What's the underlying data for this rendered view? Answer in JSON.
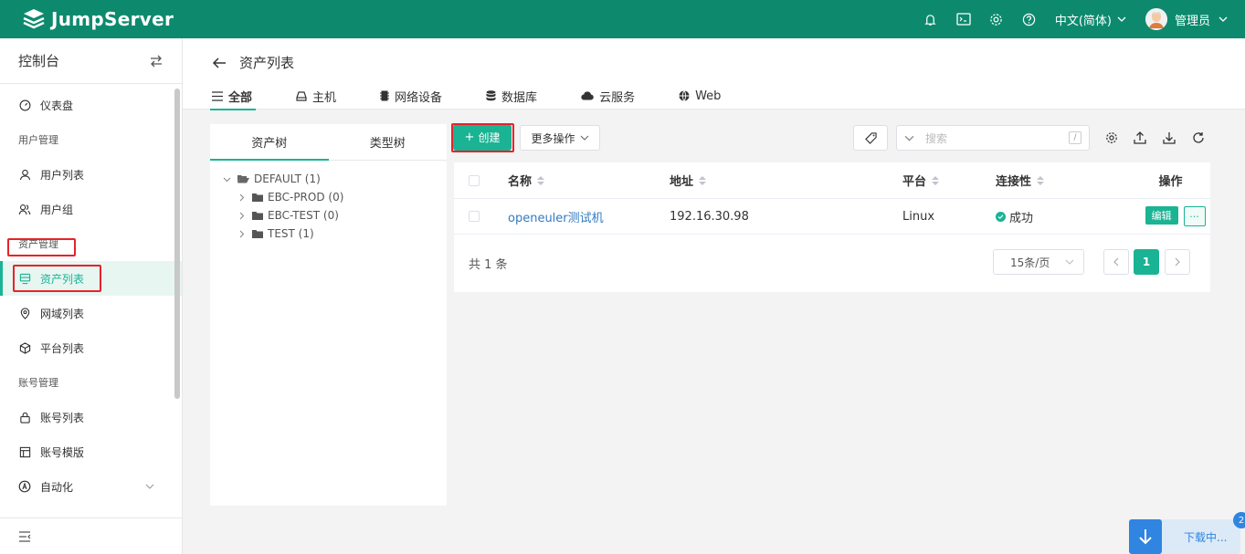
{
  "app": {
    "name": "JumpServer"
  },
  "topbar": {
    "language": "中文(简体)",
    "user": "管理员"
  },
  "sidebar": {
    "title": "控制台",
    "items": [
      {
        "label": "仪表盘"
      },
      {
        "group": "用户管理"
      },
      {
        "label": "用户列表"
      },
      {
        "label": "用户组"
      },
      {
        "group": "资产管理"
      },
      {
        "label": "资产列表"
      },
      {
        "label": "网域列表"
      },
      {
        "label": "平台列表"
      },
      {
        "group": "账号管理"
      },
      {
        "label": "账号列表"
      },
      {
        "label": "账号模版"
      },
      {
        "label": "自动化"
      }
    ]
  },
  "page": {
    "title": "资产列表",
    "tabs": [
      {
        "label": "全部"
      },
      {
        "label": "主机"
      },
      {
        "label": "网络设备"
      },
      {
        "label": "数据库"
      },
      {
        "label": "云服务"
      },
      {
        "label": "Web"
      }
    ]
  },
  "tree": {
    "tabs": [
      {
        "label": "资产树"
      },
      {
        "label": "类型树"
      }
    ],
    "nodes": [
      {
        "label": "DEFAULT (1)"
      },
      {
        "label": "EBC-PROD (0)"
      },
      {
        "label": "EBC-TEST (0)"
      },
      {
        "label": "TEST (1)"
      }
    ]
  },
  "toolbar": {
    "create": "创建",
    "more": "更多操作",
    "search_placeholder": "搜索",
    "search_kbd": "/"
  },
  "table": {
    "columns": [
      "名称",
      "地址",
      "平台",
      "连接性",
      "操作"
    ],
    "rows": [
      {
        "name": "openeuler测试机",
        "address": "192.16.30.98",
        "platform": "Linux",
        "connectivity": "成功",
        "edit": "编辑",
        "more": "···"
      }
    ]
  },
  "pager": {
    "total": "共 1 条",
    "page_size": "15条/页",
    "current": "1"
  },
  "download": {
    "label": "下载中...",
    "count": "2"
  },
  "colors": {
    "brand": "#0d8a6e",
    "accent": "#1ab394",
    "highlight": "#e7222b"
  }
}
